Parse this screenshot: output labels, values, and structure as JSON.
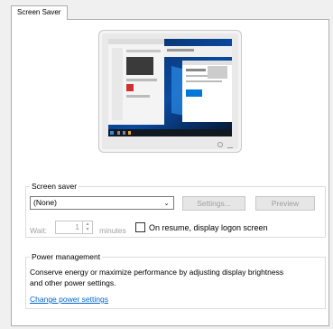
{
  "tab": {
    "label": "Screen Saver"
  },
  "screen_saver": {
    "group_title": "Screen saver",
    "selected": "(None)",
    "settings_label": "Settings...",
    "preview_label": "Preview",
    "wait_label": "Wait:",
    "wait_value": "1",
    "minutes_label": "minutes",
    "resume_label": "On resume, display logon screen"
  },
  "power": {
    "group_title": "Power management",
    "description": "Conserve energy or maximize performance by adjusting display brightness and other power settings.",
    "link": "Change power settings"
  }
}
